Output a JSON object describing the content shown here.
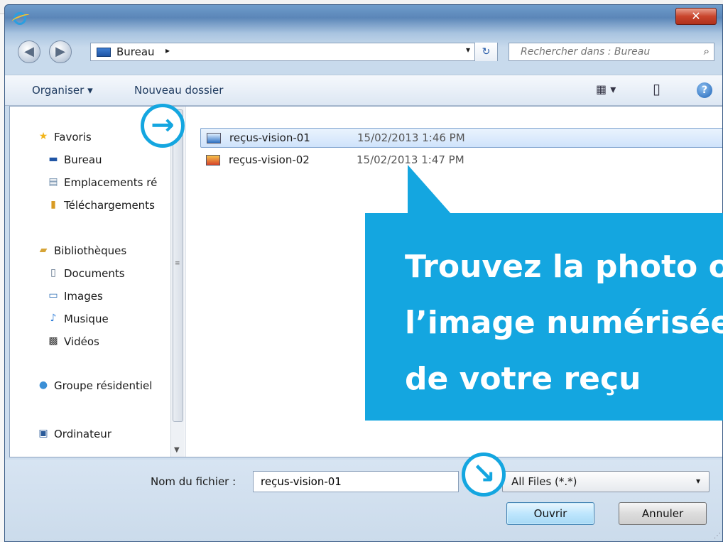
{
  "window": {
    "close_glyph": "✕"
  },
  "address": {
    "location": "Bureau",
    "crumb_arrow": "▸",
    "dropdown": "▾",
    "refresh": "↻",
    "back": "◀",
    "forward": "▶"
  },
  "search": {
    "placeholder": "Rechercher dans : Bureau",
    "icon": "⌕"
  },
  "toolbar": {
    "organize": "Organiser ▾",
    "new_folder": "Nouveau dossier",
    "views": "▦ ▾",
    "preview": "▯",
    "help": "?"
  },
  "nav": {
    "items": [
      {
        "label": "Favoris",
        "icon": "★",
        "color": "#f2b51a"
      },
      {
        "label": "Bureau",
        "icon": "▬",
        "color": "#1f55a5"
      },
      {
        "label": "Emplacements ré",
        "icon": "▤",
        "color": "#6a88a8"
      },
      {
        "label": "Téléchargements",
        "icon": "▮",
        "color": "#d89b24"
      },
      {
        "label": "Bibliothèques",
        "icon": "▰",
        "color": "#d6a437"
      },
      {
        "label": "Documents",
        "icon": "▯",
        "color": "#5a6f88"
      },
      {
        "label": "Images",
        "icon": "▭",
        "color": "#2f6fb6"
      },
      {
        "label": "Musique",
        "icon": "♪",
        "color": "#2b7bd8"
      },
      {
        "label": "Vidéos",
        "icon": "▩",
        "color": "#333"
      },
      {
        "label": "Groupe résidentiel",
        "icon": "●",
        "color": "#3b8fd6"
      },
      {
        "label": "Ordinateur",
        "icon": "▣",
        "color": "#2b5b9a"
      }
    ]
  },
  "files": [
    {
      "name": "reçus-vision-01",
      "date": "15/02/2013 1:46 PM",
      "selected": true
    },
    {
      "name": "reçus-vision-02",
      "date": "15/02/2013 1:47 PM",
      "selected": false
    }
  ],
  "bottom": {
    "filename_label": "Nom du fichier :",
    "filename_value": "reçus-vision-01",
    "filter": "All Files (*.*)",
    "filter_dd": "▾",
    "open": "Ouvrir",
    "cancel": "Annuler"
  },
  "callout": {
    "text": "Trouvez la photo ou\nl’image numérisée\nde votre reçu",
    "color": "#14a6e0"
  },
  "markers": {
    "arrow_right": "→",
    "arrow_down_right": "↘"
  }
}
